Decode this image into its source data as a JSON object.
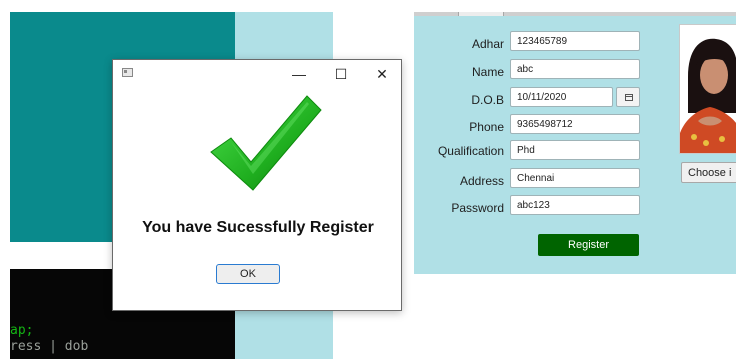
{
  "terminal": {
    "line1": "ap;",
    "line2": "ress  |       dob"
  },
  "form": {
    "fields": [
      {
        "label": "Adhar",
        "value": "123465789"
      },
      {
        "label": "Name",
        "value": "abc"
      },
      {
        "label": "D.O.B",
        "value": "10/11/2020"
      },
      {
        "label": "Phone",
        "value": "9365498712"
      },
      {
        "label": "Qualification",
        "value": "Phd"
      },
      {
        "label": "Address",
        "value": "Chennai"
      },
      {
        "label": "Password",
        "value": "abc123"
      }
    ],
    "register_label": "Register",
    "choose_image_label": "Choose i"
  },
  "dialog": {
    "minimize_glyph": "—",
    "maximize_glyph": "☐",
    "close_glyph": "✕",
    "message": "You have Sucessfully Register",
    "ok_label": "OK"
  },
  "colors": {
    "teal_panel": "#0a8a8c",
    "form_background": "#b0e0e6",
    "register_button": "#006400",
    "check_green": "#22b222"
  }
}
